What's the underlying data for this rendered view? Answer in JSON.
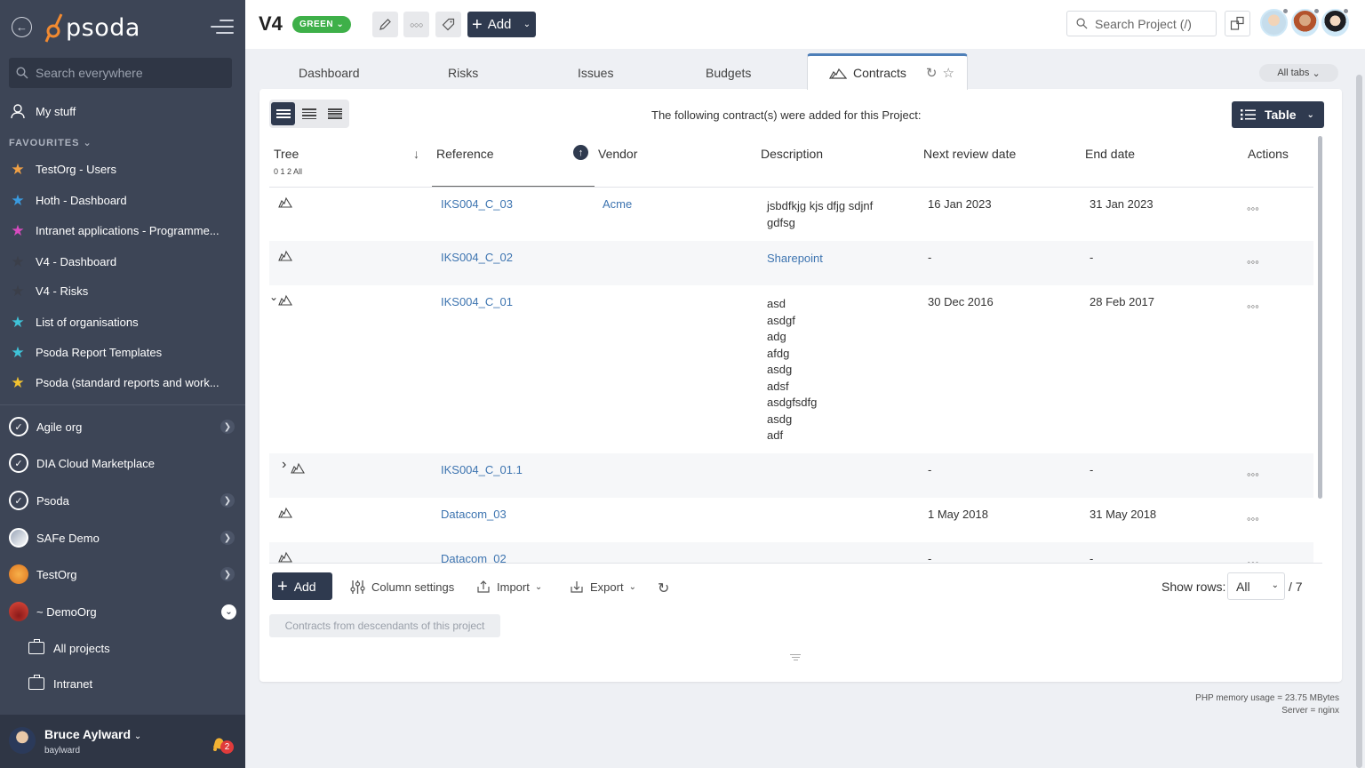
{
  "sidebar": {
    "logo_text": "psoda",
    "search_placeholder": "Search everywhere",
    "my_stuff": "My stuff",
    "favourites_label": "FAVOURITES",
    "favourites": [
      {
        "label": "TestOrg - Users",
        "color": "#f0a045"
      },
      {
        "label": "Hoth - Dashboard",
        "color": "#3a9be0"
      },
      {
        "label": "Intranet applications - Programme...",
        "color": "#d84bbf"
      },
      {
        "label": "V4 - Dashboard",
        "color": "#3b3f4a"
      },
      {
        "label": "V4 - Risks",
        "color": "#3b3f4a"
      },
      {
        "label": "List of organisations",
        "color": "#3fc3d8"
      },
      {
        "label": "Psoda Report Templates",
        "color": "#3fc3d8"
      },
      {
        "label": "Psoda (standard reports and work...",
        "color": "#f2c230"
      }
    ],
    "orgs": [
      {
        "label": "Agile org"
      },
      {
        "label": "DIA Cloud Marketplace"
      },
      {
        "label": "Psoda"
      },
      {
        "label": "SAFe Demo"
      },
      {
        "label": "TestOrg"
      },
      {
        "label": "~ DemoOrg"
      }
    ],
    "sub_items": [
      {
        "label": "All projects"
      },
      {
        "label": "Intranet"
      }
    ],
    "user": {
      "name": "Bruce Aylward",
      "handle": "baylward",
      "notifications": "2"
    }
  },
  "topbar": {
    "project_title": "V4",
    "status": "GREEN",
    "add_label": "Add",
    "search_placeholder": "Search Project (/)"
  },
  "tabs": {
    "items": [
      "Dashboard",
      "Risks",
      "Issues",
      "Budgets"
    ],
    "active": "Contracts",
    "all_tabs": "All tabs"
  },
  "panel": {
    "intro": "The following contract(s) were added for this Project:",
    "view_label": "Table",
    "columns": [
      "Tree",
      "Reference",
      "Vendor",
      "Description",
      "Next review date",
      "End date",
      "Actions"
    ],
    "tree_levels": "0 1 2 All",
    "rows": [
      {
        "ref": "IKS004_C_03",
        "vendor": "Acme",
        "desc": [
          "jsbdfkjg kjs dfjg sdjnf",
          "gdfsg"
        ],
        "desc_link": false,
        "review": "16 Jan 2023",
        "end": "31 Jan 2023"
      },
      {
        "ref": "IKS004_C_02",
        "vendor": "",
        "desc": [
          "Sharepoint"
        ],
        "desc_link": true,
        "review": "-",
        "end": "-"
      },
      {
        "ref": "IKS004_C_01",
        "vendor": "",
        "desc": [
          "asd",
          "asdgf",
          "adg",
          "afdg",
          "asdg",
          "adsf",
          "asdgfsdfg",
          "asdg",
          "adf"
        ],
        "desc_link": false,
        "review": "30 Dec 2016",
        "end": "28 Feb 2017"
      },
      {
        "ref": "IKS004_C_01.1",
        "vendor": "",
        "desc": [],
        "desc_link": false,
        "review": "-",
        "end": "-"
      },
      {
        "ref": "Datacom_03",
        "vendor": "",
        "desc": [],
        "desc_link": false,
        "review": "1 May 2018",
        "end": "31 May 2018"
      },
      {
        "ref": "Datacom_02",
        "vendor": "",
        "desc": [],
        "desc_link": false,
        "review": "-",
        "end": "-"
      }
    ],
    "footer": {
      "add_label": "Add",
      "column_settings": "Column settings",
      "import": "Import",
      "export": "Export",
      "show_rows_label": "Show rows:",
      "show_rows_value": "All",
      "rows_total": "/ 7",
      "descendants_button": "Contracts from descendants of this project"
    }
  },
  "server_info": {
    "memory": "PHP memory usage = 23.75 MBytes",
    "server": "Server = nginx"
  }
}
